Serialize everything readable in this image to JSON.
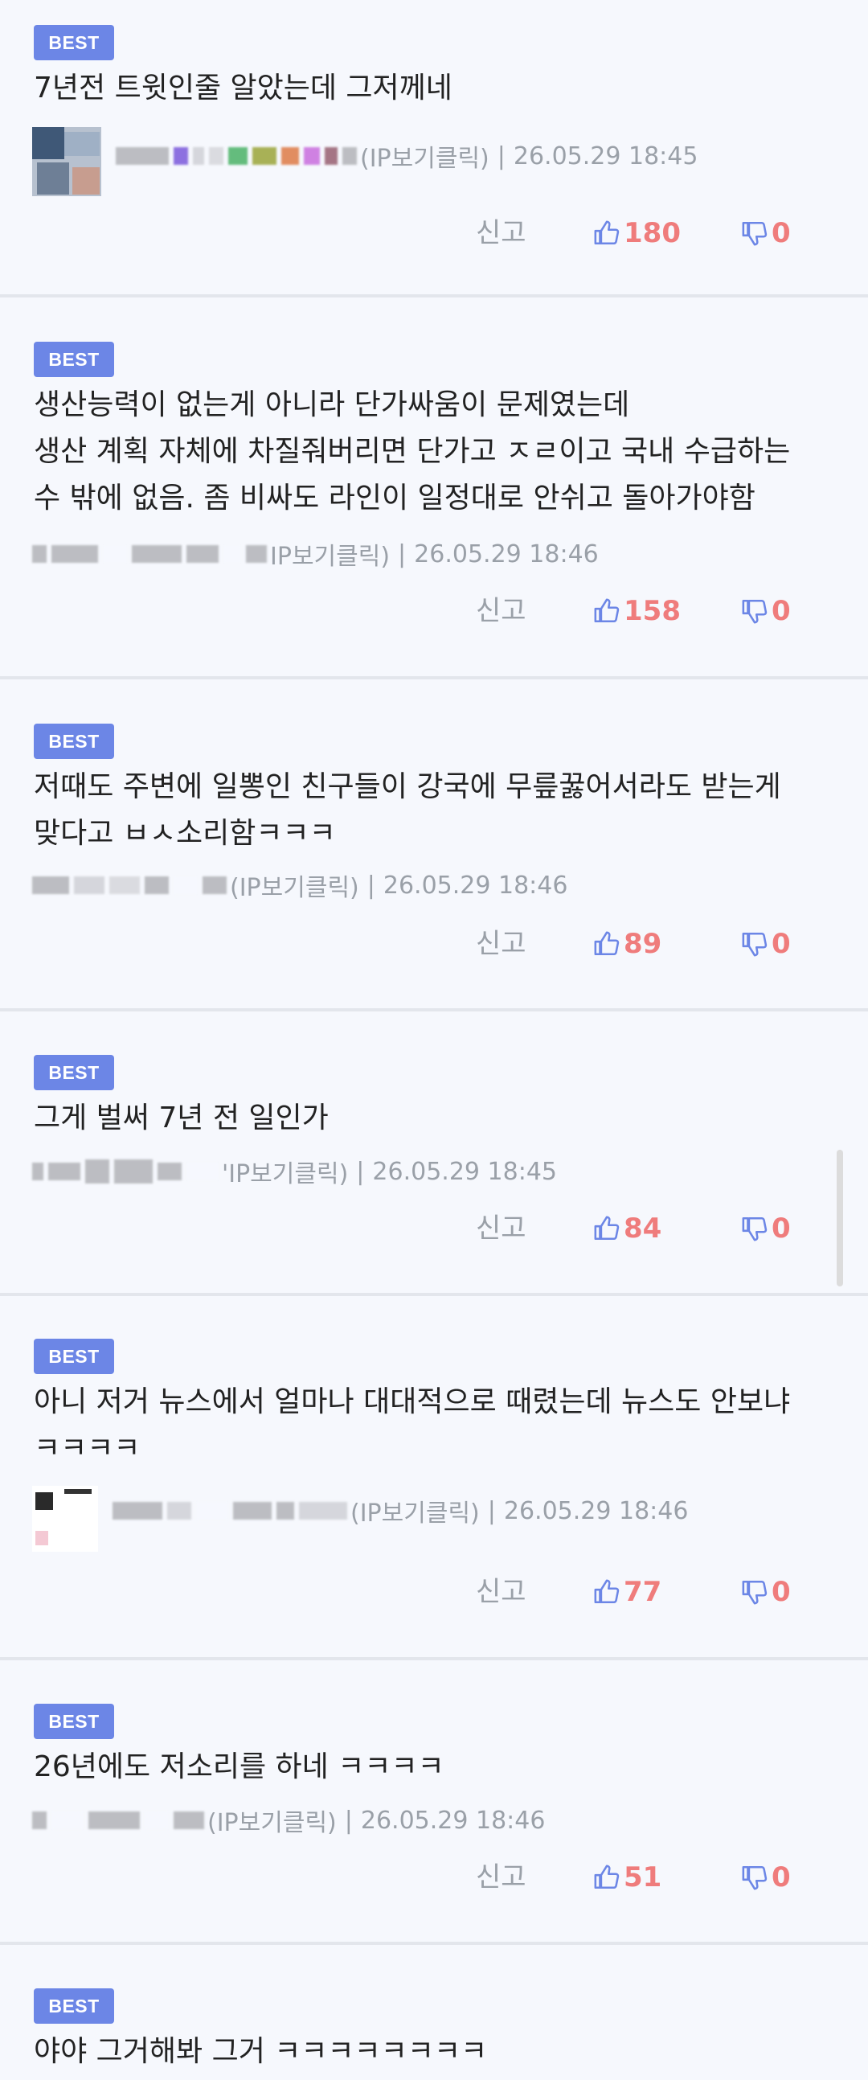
{
  "comments": [
    {
      "badge": "BEST",
      "text": "7년전 트윗인줄 알았는데 그저께네",
      "ip_label": "(IP보기클릭)",
      "separator": "|",
      "timestamp": "26.05.29 18:45",
      "report_label": "신고",
      "likes": "180",
      "dislikes": "0"
    },
    {
      "badge": "BEST",
      "text": "생산능력이 없는게 아니라 단가싸움이 문제였는데\n생산 계획 자체에 차질줘버리면 단가고 ㅈㄹ이고 국내 수급하는\n수 밖에 없음. 좀 비싸도 라인이 일정대로 안쉬고 돌아가야함",
      "ip_label": "IP보기클릭)",
      "separator": "|",
      "timestamp": "26.05.29 18:46",
      "report_label": "신고",
      "likes": "158",
      "dislikes": "0"
    },
    {
      "badge": "BEST",
      "text": "저때도 주변에 일뽕인 친구들이 강국에 무릎꿇어서라도 받는게\n맞다고 ㅂㅅ소리함ㅋㅋㅋ",
      "ip_label": "(IP보기클릭)",
      "separator": "|",
      "timestamp": "26.05.29 18:46",
      "report_label": "신고",
      "likes": "89",
      "dislikes": "0"
    },
    {
      "badge": "BEST",
      "text": "그게 벌써 7년 전 일인가",
      "ip_label": "'IP보기클릭)",
      "separator": "|",
      "timestamp": "26.05.29 18:45",
      "report_label": "신고",
      "likes": "84",
      "dislikes": "0"
    },
    {
      "badge": "BEST",
      "text": "아니 저거 뉴스에서 얼마나 대대적으로 때렸는데 뉴스도 안보냐\nㅋㅋㅋㅋ",
      "ip_label": "(IP보기클릭)",
      "separator": "|",
      "timestamp": "26.05.29 18:46",
      "report_label": "신고",
      "likes": "77",
      "dislikes": "0"
    },
    {
      "badge": "BEST",
      "text": "26년에도 저소리를 하네 ㅋㅋㅋㅋ",
      "ip_label": "(IP보기클릭)",
      "separator": "|",
      "timestamp": "26.05.29 18:46",
      "report_label": "신고",
      "likes": "51",
      "dislikes": "0"
    },
    {
      "badge": "BEST",
      "text": "야야 그거해봐 그거 ㅋㅋㅋㅋㅋㅋㅋㅋ"
    }
  ],
  "colors": {
    "background": "#f6f8fd",
    "badge": "#6c86e6",
    "vote_count": "#ef7c7c",
    "muted_text": "#9aa0a8",
    "divider": "#e3e6ec"
  },
  "icons": {
    "like": "thumbs-up-icon",
    "dislike": "thumbs-down-icon"
  }
}
